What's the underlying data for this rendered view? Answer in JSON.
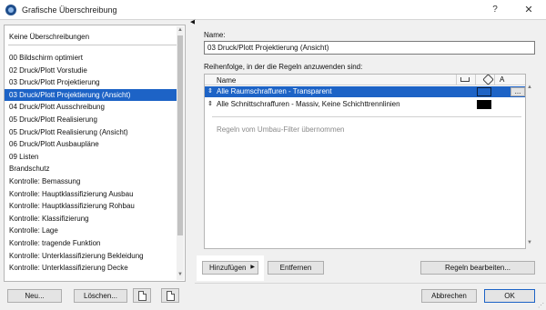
{
  "window": {
    "title": "Grafische Überschreibung",
    "help": "?",
    "close": "✕"
  },
  "sidebar": {
    "header": "Keine Überschreibungen",
    "items": [
      {
        "label": "00 Bildschirm optimiert",
        "selected": false
      },
      {
        "label": "02 Druck/Plott Vorstudie",
        "selected": false
      },
      {
        "label": "03 Druck/Plott Projektierung",
        "selected": false
      },
      {
        "label": "03 Druck/Plott Projektierung (Ansicht)",
        "selected": true
      },
      {
        "label": "04 Druck/Plott Ausschreibung",
        "selected": false
      },
      {
        "label": "05 Druck/Plott Realisierung",
        "selected": false
      },
      {
        "label": "05 Druck/Plott Realisierung (Ansicht)",
        "selected": false
      },
      {
        "label": "06 Druck/Plott Ausbaupläne",
        "selected": false
      },
      {
        "label": "09 Listen",
        "selected": false
      },
      {
        "label": "Brandschutz",
        "selected": false
      },
      {
        "label": "Kontrolle: Bemassung",
        "selected": false
      },
      {
        "label": "Kontrolle: Hauptklassifizierung Ausbau",
        "selected": false
      },
      {
        "label": "Kontrolle: Hauptklassifizierung Rohbau",
        "selected": false
      },
      {
        "label": "Kontrolle: Klassifizierung",
        "selected": false
      },
      {
        "label": "Kontrolle: Lage",
        "selected": false
      },
      {
        "label": "Kontrolle: tragende Funktion",
        "selected": false
      },
      {
        "label": "Kontrolle: Unterklassifizierung Bekleidung",
        "selected": false
      },
      {
        "label": "Kontrolle: Unterklassifizierung Decke",
        "selected": false
      }
    ],
    "new_button": "Neu...",
    "delete_button": "Löschen..."
  },
  "detail": {
    "name_label": "Name:",
    "name_value": "03 Druck/Plott Projektierung (Ansicht)",
    "order_label": "Reihenfolge, in der die Regeln anzuwenden sind:",
    "table_header": {
      "name": "Name",
      "pen_glyph": "A"
    },
    "rules": [
      {
        "name": "Alle Raumschraffuren - Transparent",
        "swatch_color": "#1d63c6",
        "selected": true,
        "edit": "..."
      },
      {
        "name": "Alle Schnittschraffuren - Massiv, Keine Schichttrennlinien",
        "swatch_color": "#000000",
        "selected": false
      }
    ],
    "filter_option": "Regeln vom Umbau-Filter übernommen",
    "add_button": "Hinzufügen",
    "remove_button": "Entfernen",
    "edit_rules_button": "Regeln bearbeiten..."
  },
  "footer": {
    "cancel_button": "Abbrechen",
    "ok_button": "OK"
  },
  "colors": {
    "selection": "#1d63c6"
  }
}
